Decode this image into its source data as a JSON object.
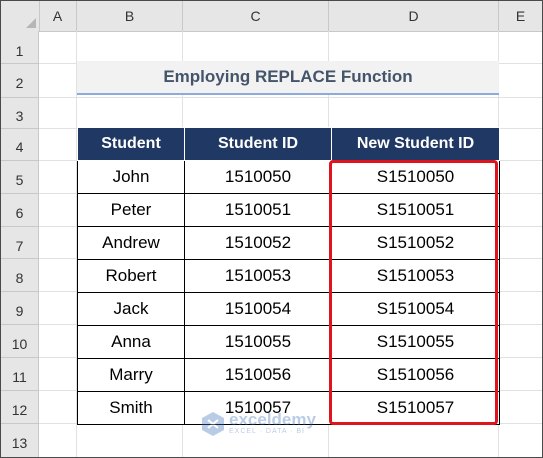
{
  "columns": [
    "A",
    "B",
    "C",
    "D",
    "E"
  ],
  "rows": [
    "1",
    "2",
    "3",
    "4",
    "5",
    "6",
    "7",
    "8",
    "9",
    "10",
    "11",
    "12",
    "13"
  ],
  "title": "Employing REPLACE Function",
  "table": {
    "headers": [
      "Student",
      "Student ID",
      "New Student ID"
    ],
    "rows": [
      [
        "John",
        "1510050",
        "S1510050"
      ],
      [
        "Peter",
        "1510051",
        "S1510051"
      ],
      [
        "Andrew",
        "1510052",
        "S1510052"
      ],
      [
        "Robert",
        "1510053",
        "S1510053"
      ],
      [
        "Jack",
        "1510054",
        "S1510054"
      ],
      [
        "Anna",
        "1510055",
        "S1510055"
      ],
      [
        "Marry",
        "1510056",
        "S1510056"
      ],
      [
        "Smith",
        "1510057",
        "S1510057"
      ]
    ]
  },
  "highlight_color": "#e0141e",
  "header_fill_color": "#203864",
  "watermark": {
    "name": "exceldemy",
    "tagline": "EXCEL · DATA · BI",
    "icon": "exceldemy-logo-icon"
  }
}
